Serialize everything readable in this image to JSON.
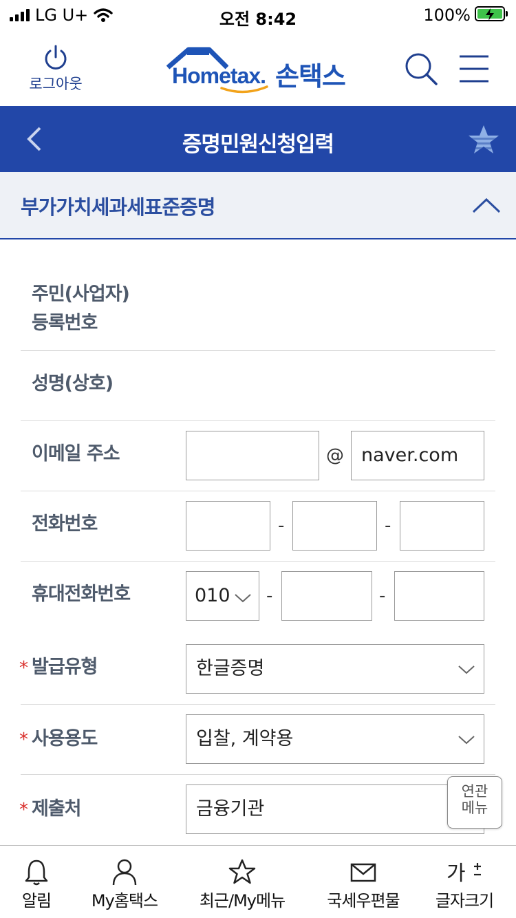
{
  "status_bar": {
    "carrier": "LG U+",
    "time": "오전 8:42",
    "battery": "100%"
  },
  "header": {
    "logout_label": "로그아웃",
    "logo_text": "Hometax.",
    "brand_name": "손택스",
    "brand_color": "#1e54b7"
  },
  "title_bar": {
    "title": "증명민원신청입력",
    "bg_color": "#2247a8"
  },
  "section": {
    "name": "부가가치세과세표준증명"
  },
  "form": {
    "id_label_line1": "주민(사업자)",
    "id_label_line2": "등록번호",
    "name_label": "성명(상호)",
    "email_label": "이메일 주소",
    "email_user": "",
    "email_at": "@",
    "email_domain": "naver.com",
    "phone_label": "전화번호",
    "phone_1": "",
    "phone_2": "",
    "phone_3": "",
    "dash": "-",
    "mobile_label": "휴대전화번호",
    "mobile_prefix": "010",
    "mobile_2": "",
    "mobile_3": "",
    "required_mark": "*",
    "issue_type_label": "발급유형",
    "issue_type_value": "한글증명",
    "purpose_label": "사용용도",
    "purpose_value": "입찰, 계약용",
    "submit_to_label": "제출처",
    "submit_to_value": "금융기관"
  },
  "related_menu": {
    "line1": "연관",
    "line2": "메뉴"
  },
  "tab_bar": {
    "items": [
      {
        "label": "알림",
        "icon": "bell-icon"
      },
      {
        "label": "My홈택스",
        "icon": "person-icon"
      },
      {
        "label": "최근/My메뉴",
        "icon": "star-icon"
      },
      {
        "label": "국세우편물",
        "icon": "mail-icon"
      },
      {
        "label": "글자크기",
        "icon": "font-size-icon"
      }
    ]
  },
  "accent_required_color": "#d9302c"
}
